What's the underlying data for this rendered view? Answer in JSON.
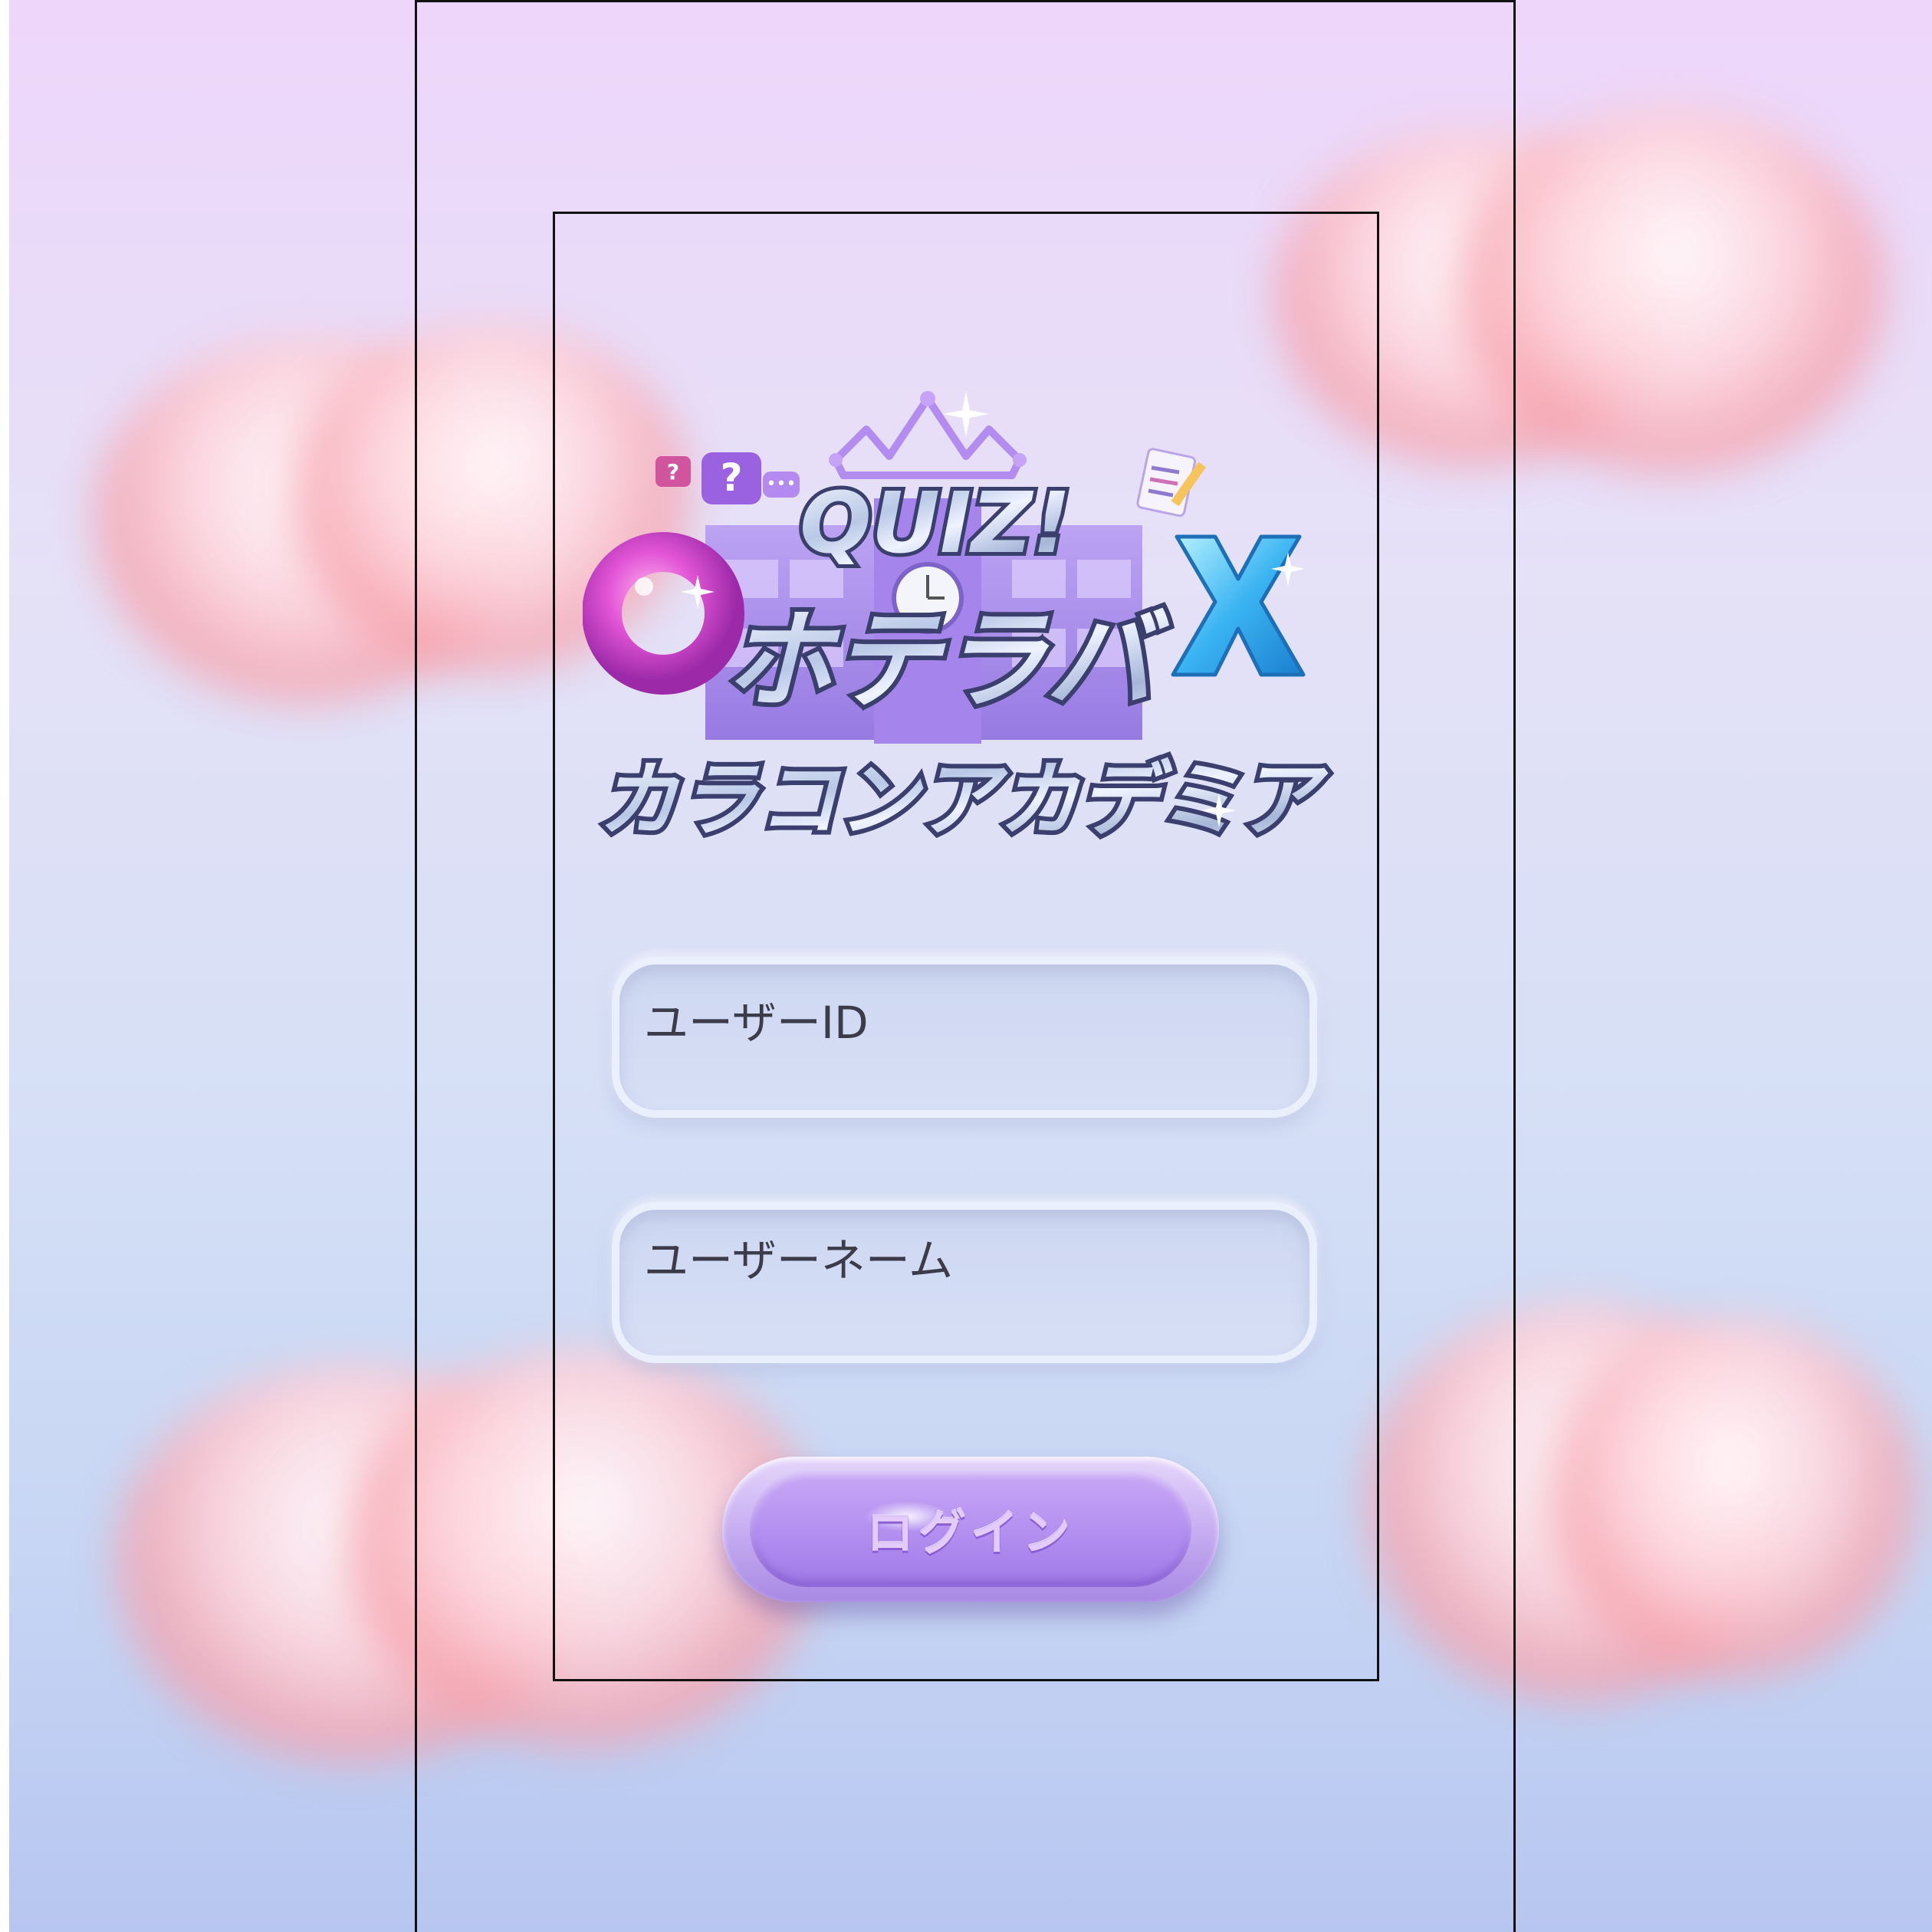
{
  "logo": {
    "quiz_text": "QUIZ!",
    "circle_symbol": "O",
    "cross_symbol": "X",
    "title_line1": "ホテラバ",
    "title_line2": "カラコンアカデミア",
    "icons": [
      "question-bubble-icon",
      "question-bubble-icon",
      "chat-dots-icon",
      "notepad-pencil-icon",
      "crown-icon",
      "clock-icon",
      "school-building-icon"
    ]
  },
  "form": {
    "user_id_placeholder": "ユーザーID",
    "user_name_placeholder": "ユーザーネーム",
    "login_label": "ログイン"
  },
  "colors": {
    "background_top": "#eed6fb",
    "background_bottom": "#b7c6f0",
    "button_purple": "#b28ff0",
    "circle_pink": "#e255d6",
    "cross_blue": "#3bb4f2",
    "logo_outline": "#3b3f6e"
  }
}
